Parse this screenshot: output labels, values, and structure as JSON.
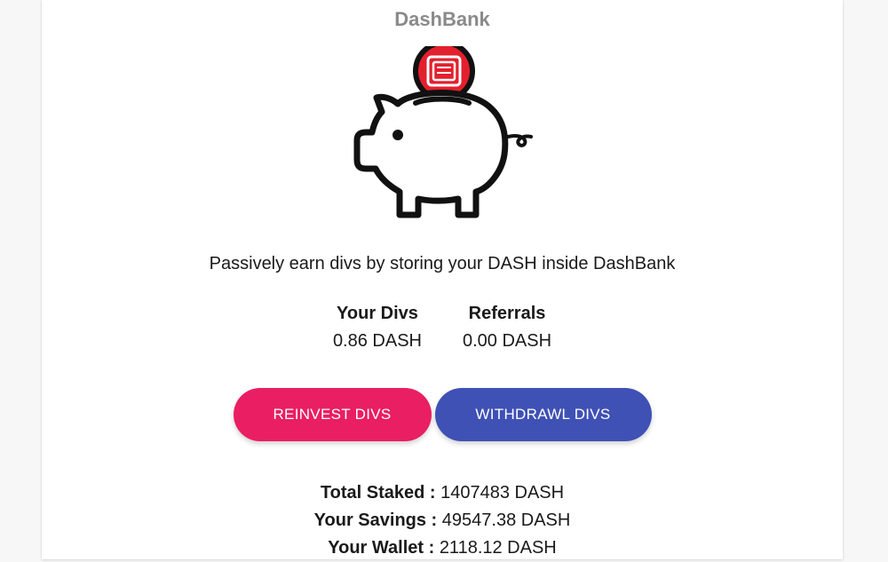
{
  "app": {
    "title": "DashBank",
    "tagline": "Passively earn divs by storing your DASH inside DashBank"
  },
  "stats": {
    "your_divs_label": "Your Divs",
    "your_divs_value": "0.86 DASH",
    "referrals_label": "Referrals",
    "referrals_value": "0.00 DASH"
  },
  "actions": {
    "reinvest_label": "REINVEST DIVS",
    "withdraw_label": "WITHDRAWL DIVS"
  },
  "totals": {
    "total_staked_label": "Total Staked :",
    "total_staked_value": "1407483 DASH",
    "your_savings_label": "Your Savings :",
    "your_savings_value": "49547.38 DASH",
    "your_wallet_label": "Your Wallet :",
    "your_wallet_value": "2118.12 DASH"
  },
  "icons": {
    "hero": "piggy-bank-icon",
    "coin": "dash-coin-icon"
  },
  "colors": {
    "reinvest_button": "#e91e63",
    "withdraw_button": "#3f51b5",
    "coin_red": "#e3202e",
    "title_gray": "#8a8a8a"
  }
}
